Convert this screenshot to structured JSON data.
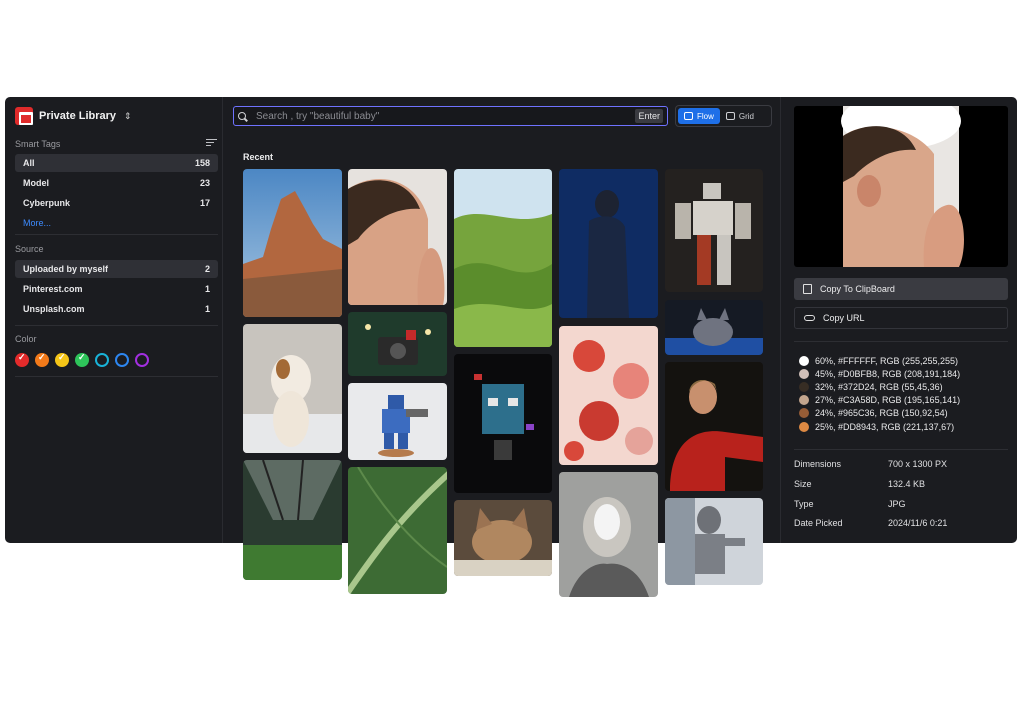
{
  "sidebar": {
    "brand_title": "Private Library",
    "smart_tags_title": "Smart Tags",
    "tags": [
      {
        "label": "All",
        "count": "158"
      },
      {
        "label": "Model",
        "count": "23"
      },
      {
        "label": "Cyberpunk",
        "count": "17"
      }
    ],
    "more_label": "More...",
    "source_title": "Source",
    "sources": [
      {
        "label": "Uploaded by myself",
        "count": "2"
      },
      {
        "label": "Pinterest.com",
        "count": "1"
      },
      {
        "label": "Unsplash.com",
        "count": "1"
      }
    ],
    "color_title": "Color",
    "color_filters": [
      "#e32b2b",
      "#f27a1a",
      "#f5c518",
      "#2ec45a",
      "#19b2d8",
      "#2d86f0",
      "#a22fe0"
    ]
  },
  "search": {
    "placeholder": "Search , try \"beautiful baby\"",
    "enter_label": "Enter"
  },
  "view_toggle": {
    "flow_label": "Flow",
    "grid_label": "Grid",
    "active": "Flow"
  },
  "section_title": "Recent",
  "gallery": [
    "red rock desert",
    "baby ear closeup",
    "green hills",
    "woman in blue",
    "mech robot",
    "dog in snow",
    "camera with bow",
    "blue robot figurine",
    "glitch face",
    "red flowers",
    "gray cat",
    "girl in red",
    "greenhouse interior",
    "green leaf",
    "tabby cat",
    "woman with paper mask",
    "silver android"
  ],
  "preview": {
    "subject": "baby ear closeup"
  },
  "actions": {
    "copy_clipboard": "Copy To ClipBoard",
    "copy_url": "Copy URL"
  },
  "palette": [
    {
      "text": "60%,  #FFFFFF,  RGB (255,255,255)",
      "color": "#FFFFFF"
    },
    {
      "text": "45%,  #D0BFB8,  RGB (208,191,184)",
      "color": "#D0BFB8"
    },
    {
      "text": "32%,  #372D24,  RGB (55,45,36)",
      "color": "#372D24"
    },
    {
      "text": "27%,  #C3A58D,  RGB (195,165,141)",
      "color": "#C3A58D"
    },
    {
      "text": "24%,  #965C36,  RGB (150,92,54)",
      "color": "#965C36"
    },
    {
      "text": "25%,  #DD8943,  RGB (221,137,67)",
      "color": "#DD8943"
    }
  ],
  "meta": [
    {
      "key": "Dimensions",
      "value": "700 x 1300 PX"
    },
    {
      "key": "Size",
      "value": "132.4 KB"
    },
    {
      "key": "Type",
      "value": "JPG"
    },
    {
      "key": "Date Picked",
      "value": "2024/11/6 0:21"
    }
  ]
}
